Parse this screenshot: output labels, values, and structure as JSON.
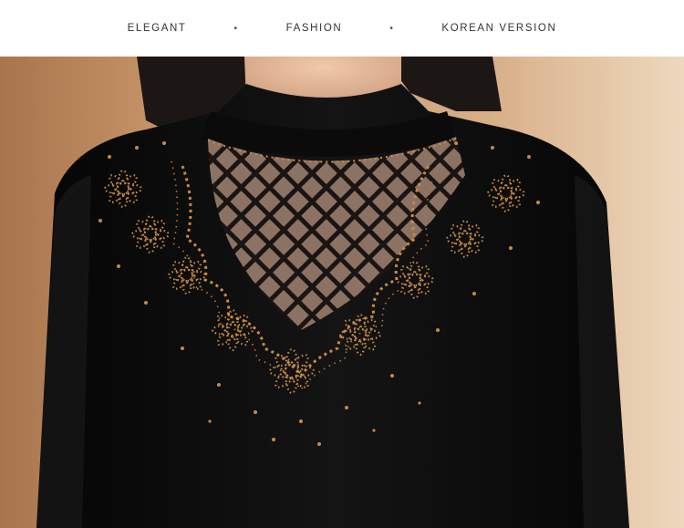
{
  "tagline": {
    "items": [
      "ELEGANT",
      "FASHION",
      "KOREAN VERSION"
    ],
    "separator": "•"
  },
  "photo": {
    "subject": "black-sweater-embellished-neckline",
    "colors": {
      "background_warm": "#c89565",
      "background_light": "#e8cfae",
      "garment": "#0b0b0c",
      "skin": "#e3b89a",
      "hair": "#1c1714",
      "rhinestone": "#c88a45",
      "mesh": "#7a6a60"
    }
  }
}
